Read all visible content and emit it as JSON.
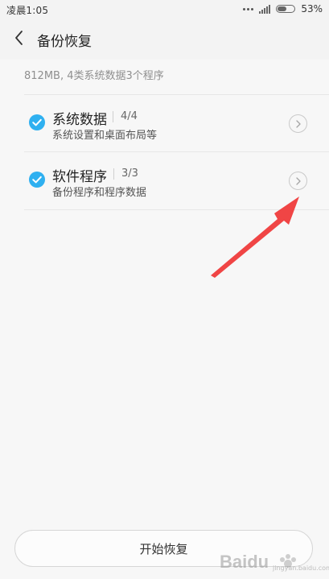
{
  "status_bar": {
    "time": "凌晨1:05",
    "battery_percent": "53%",
    "battery_level": 0.53,
    "icons": [
      "signal-dots-icon",
      "signal-bars-icon",
      "battery-icon"
    ]
  },
  "header": {
    "back_icon": "chevron-left-icon",
    "title": "备份恢复"
  },
  "summary": {
    "text": "812MB, 4类系统数据3个程序"
  },
  "items": [
    {
      "title": "系统数据",
      "count": "4/4",
      "description": "系统设置和桌面布局等",
      "checked": true
    },
    {
      "title": "软件程序",
      "count": "3/3",
      "description": "备份程序和程序数据",
      "checked": true
    }
  ],
  "actions": {
    "start_restore": "开始恢复"
  },
  "annotation": {
    "type": "arrow",
    "color": "#f04545"
  },
  "watermark": {
    "text": "Baidu",
    "sub_text": "jingyan.baidu.com"
  },
  "colors": {
    "accent": "#2fb0f0",
    "arrow": "#f04545"
  }
}
